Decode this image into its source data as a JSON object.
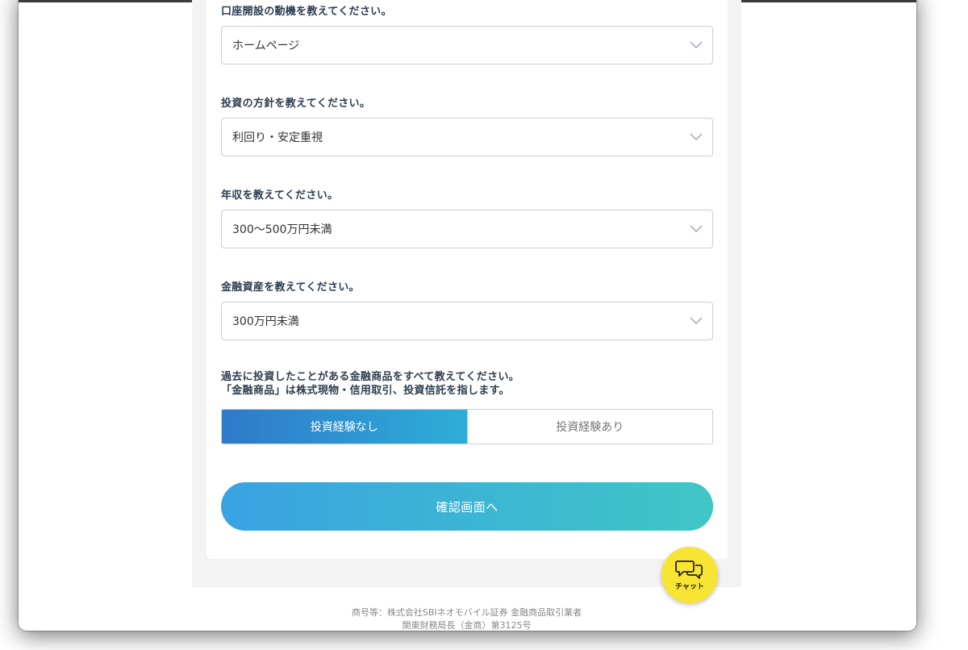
{
  "form": {
    "questions": [
      {
        "label": "口座開設の動機を教えてください。",
        "value": "ホームページ"
      },
      {
        "label": "投資の方針を教えてください。",
        "value": "利回り・安定重視"
      },
      {
        "label": "年収を教えてください。",
        "value": "300〜500万円未満"
      },
      {
        "label": "金融資産を教えてください。",
        "value": "300万円未満"
      }
    ],
    "experience": {
      "label_line1": "過去に投資したことがある金融商品をすべて教えてください。",
      "label_line2": "「金融商品」は株式現物・信用取引、投資信託を指します。",
      "option_none": "投資経験なし",
      "option_yes": "投資経験あり",
      "selected": "投資経験なし"
    },
    "confirm_label": "確認画面へ"
  },
  "chat": {
    "label": "チャット",
    "icon": "chat-bubbles-icon"
  },
  "footer": {
    "line1": "商号等：株式会社SBIネオモバイル証券 金融商品取引業者",
    "line2": "関東財務局長（金商）第3125号"
  },
  "colors": {
    "accent_start": "#2f79c9",
    "accent_end": "#2eaed8",
    "button_start": "#39a3e2",
    "button_end": "#40c6c6",
    "chat_yellow": "#f8e433",
    "label_text": "#2c3e50"
  }
}
